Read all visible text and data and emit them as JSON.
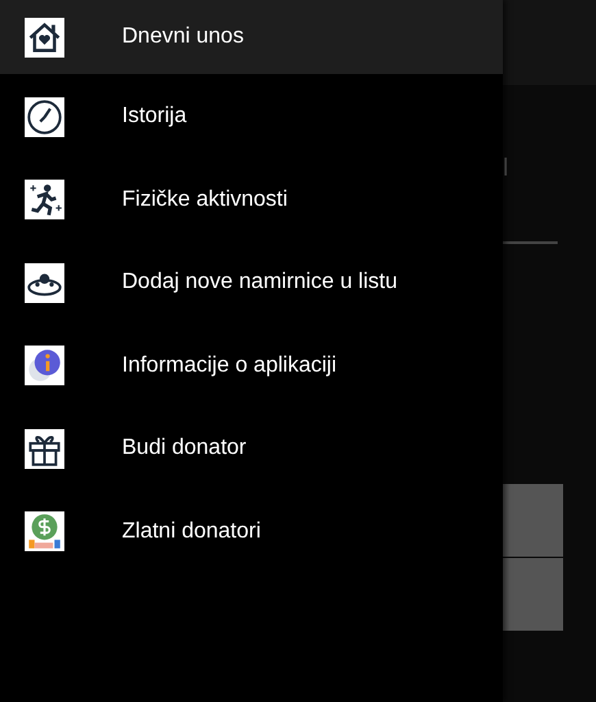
{
  "drawer": {
    "items": [
      {
        "kind": "home",
        "label": "Dnevni unos",
        "selected": true
      },
      {
        "kind": "clock",
        "label": "Istorija",
        "selected": false
      },
      {
        "kind": "runner",
        "label": "Fizičke aktivnosti",
        "selected": false
      },
      {
        "kind": "bowl",
        "label": "Dodaj nove namirnice u listu",
        "selected": false
      },
      {
        "kind": "info",
        "label": "Informacije o aplikaciji",
        "selected": false
      },
      {
        "kind": "gift",
        "label": "Budi donator",
        "selected": false
      },
      {
        "kind": "money",
        "label": "Zlatni donatori",
        "selected": false
      }
    ]
  },
  "background": {
    "label_fragment": "l"
  }
}
